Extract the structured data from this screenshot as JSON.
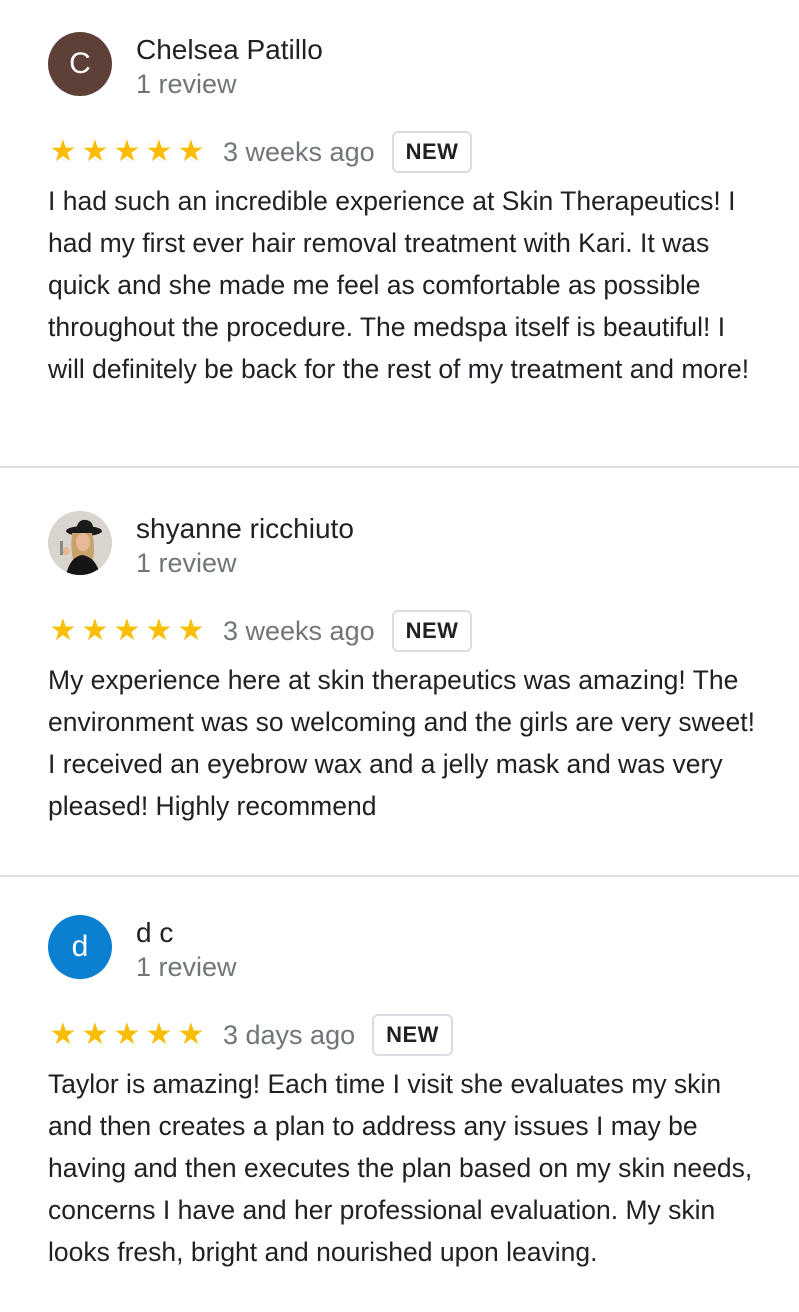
{
  "reviews": [
    {
      "author": "Chelsea Patillo",
      "avatar_letter": "C",
      "avatar_color": "#5d4037",
      "review_count": "1 review",
      "rating": 5,
      "time": "3 weeks ago",
      "badge": "NEW",
      "text": "I had such an incredible experience at Skin Therapeutics! I had my first ever hair removal treatment with Kari. It was quick and she made me feel as comfortable as possible throughout the procedure. The medspa itself is beautiful! I will definitely be back for the rest of my treatment and more!"
    },
    {
      "author": "shyanne ricchiuto",
      "avatar_letter": "",
      "avatar_color": "#d7d2cc",
      "review_count": "1 review",
      "rating": 5,
      "time": "3 weeks ago",
      "badge": "NEW",
      "text": "My experience here at skin therapeutics was amazing! The environment was so welcoming and the girls are very sweet! I received an eyebrow wax and a jelly mask and was very pleased! Highly recommend"
    },
    {
      "author": "d c",
      "avatar_letter": "d",
      "avatar_color": "#0b7fd0",
      "review_count": "1 review",
      "rating": 5,
      "time": "3 days ago",
      "badge": "NEW",
      "text": "Taylor is amazing! Each time I visit she evaluates my skin and then creates a plan to address any issues I may be having and then executes the plan based on my skin needs, concerns I have and her professional evaluation. My skin looks fresh, bright and nourished upon leaving."
    }
  ],
  "colors": {
    "star": "#fbbc04",
    "secondary_text": "#70757a",
    "divider": "#e0e0e0"
  },
  "icons": {
    "star": "star-icon"
  }
}
